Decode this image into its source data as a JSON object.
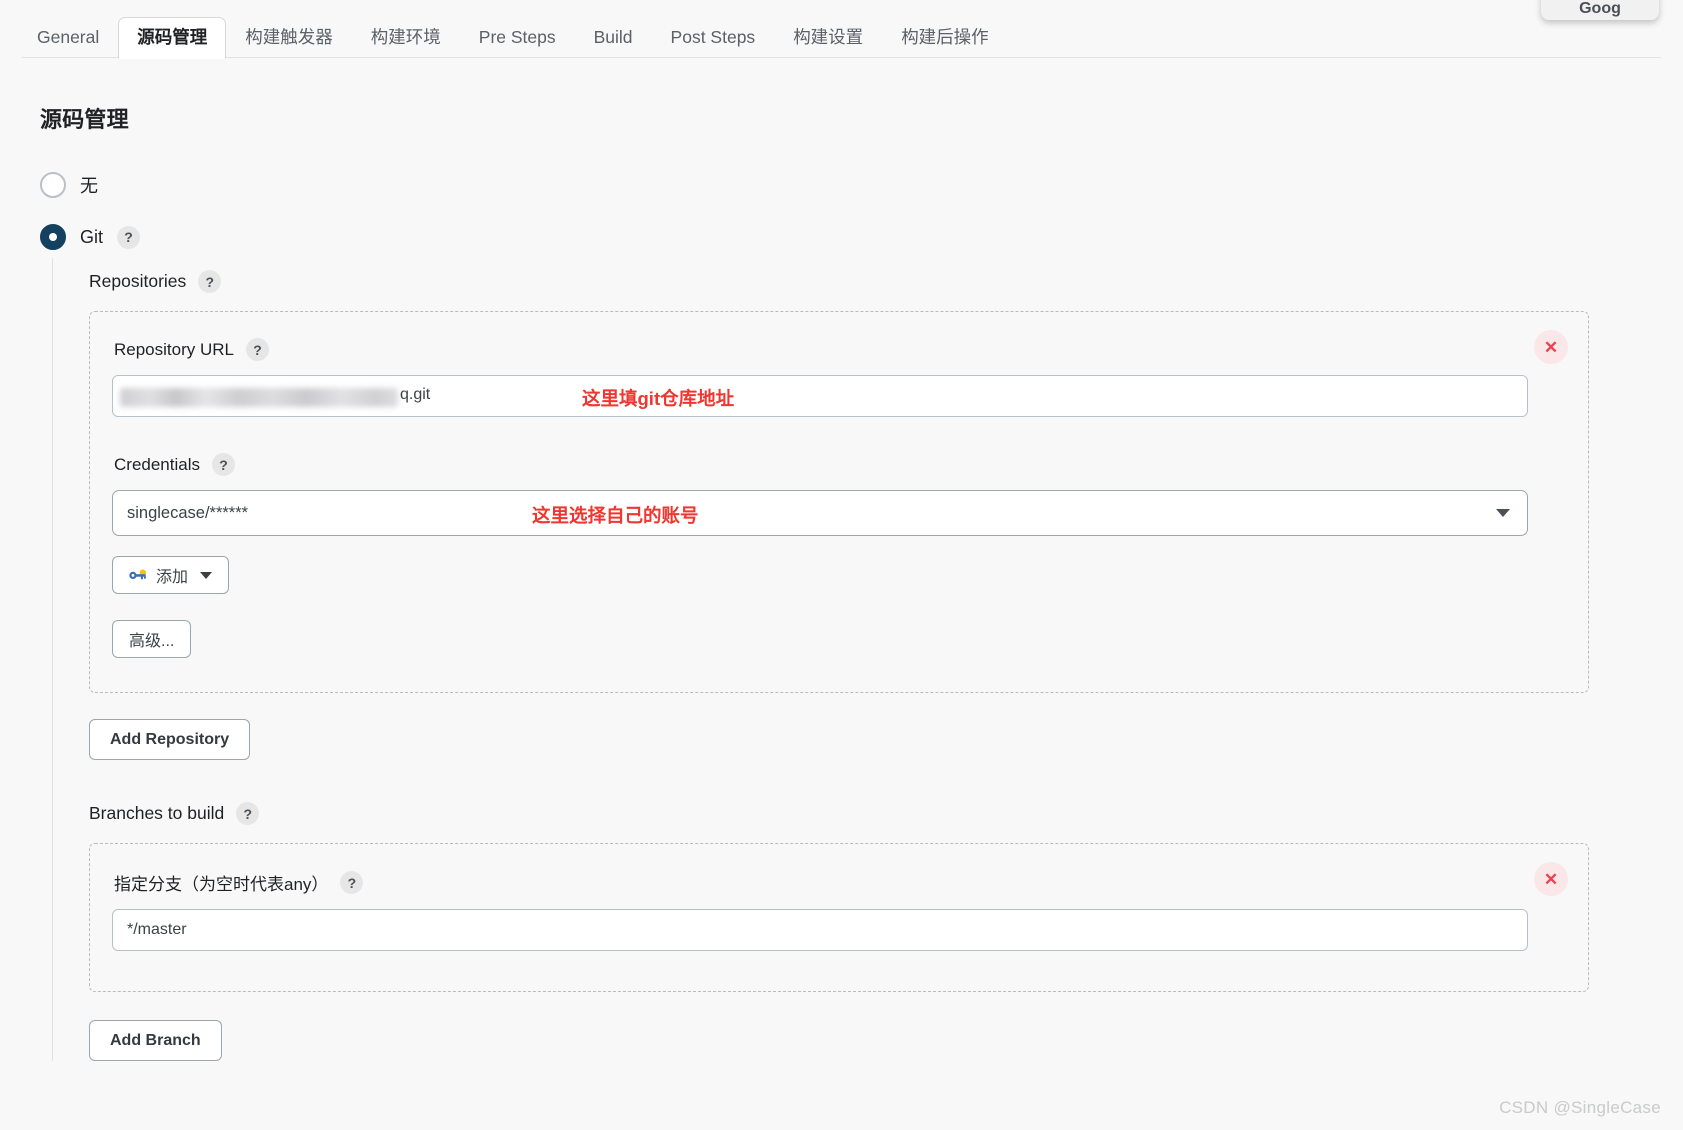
{
  "float_chip": {
    "label": "Goog"
  },
  "tabs": [
    {
      "label": "General",
      "active": false
    },
    {
      "label": "源码管理",
      "active": true
    },
    {
      "label": "构建触发器",
      "active": false
    },
    {
      "label": "构建环境",
      "active": false
    },
    {
      "label": "Pre Steps",
      "active": false
    },
    {
      "label": "Build",
      "active": false
    },
    {
      "label": "Post Steps",
      "active": false
    },
    {
      "label": "构建设置",
      "active": false
    },
    {
      "label": "构建后操作",
      "active": false
    }
  ],
  "page_title": "源码管理",
  "scm_options": [
    {
      "label": "无",
      "checked": false
    },
    {
      "label": "Git",
      "checked": true,
      "help": "?"
    }
  ],
  "repositories": {
    "label": "Repositories",
    "help": "?",
    "repo": {
      "url_label": "Repository URL",
      "url_help": "?",
      "url_value": "",
      "url_redacted": true,
      "url_tail": "q.git",
      "url_annotation": "这里填git仓库地址",
      "credentials_label": "Credentials",
      "credentials_help": "?",
      "credentials_value": "singlecase/******",
      "credentials_annotation": "这里选择自己的账号",
      "add_credential_label": "添加",
      "advanced_label": "高级...",
      "delete_label": "✕"
    },
    "add_repository_label": "Add Repository"
  },
  "branches": {
    "label": "Branches to build",
    "help": "?",
    "branch": {
      "spec_label": "指定分支（为空时代表any）",
      "spec_help": "?",
      "spec_value": "*/master",
      "delete_label": "✕"
    },
    "add_branch_label": "Add Branch"
  },
  "watermark": "CSDN @SingleCase",
  "colors": {
    "accent": "#13415f",
    "annotation_red": "#f1352f",
    "delete_red": "#e8434f",
    "page_bg": "#f8f8f8"
  }
}
